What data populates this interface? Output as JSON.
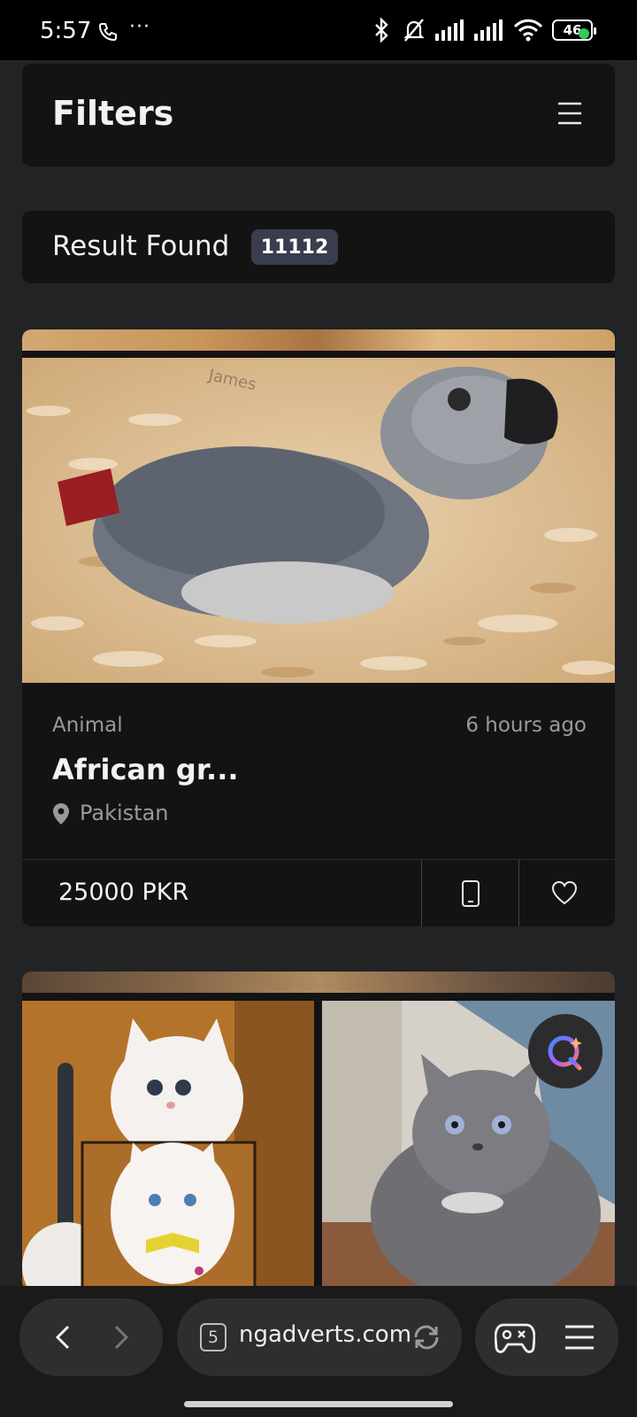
{
  "status_bar": {
    "time": "5:57",
    "dots": "···",
    "battery": "46"
  },
  "filters": {
    "title": "Filters"
  },
  "results": {
    "label": "Result Found",
    "count": "11112"
  },
  "listing": {
    "category": "Animal",
    "time_ago": "6 hours ago",
    "title": "African gr...",
    "location": "Pakistan",
    "price": "25000 PKR",
    "watermark": "James"
  },
  "browser": {
    "tab_count": "5",
    "url": "ngadverts.com"
  },
  "colors": {
    "background": "#222325",
    "card": "#131313",
    "badge": "#3a3d4d",
    "status_dot": "#2ecc55"
  }
}
